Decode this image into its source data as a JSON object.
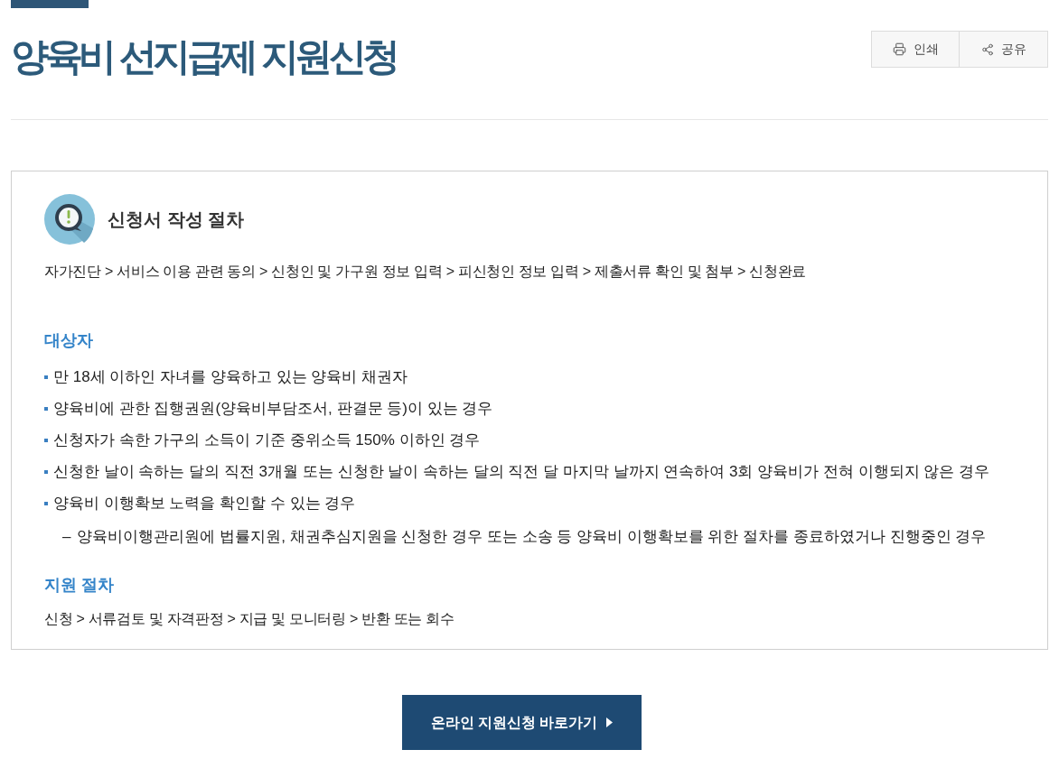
{
  "header": {
    "title": "양육비 선지급제 지원신청",
    "actions": [
      {
        "kind": "print",
        "label": "인쇄"
      },
      {
        "kind": "share",
        "label": "공유"
      }
    ]
  },
  "panel": {
    "heading": "신청서 작성 절차",
    "steps": "자가진단 > 서비스 이용 관련 동의 > 신청인 및 가구원 정보 입력 > 피신청인 정보 입력 > 제출서류 확인 및 첨부 > 신청완료",
    "sections": [
      {
        "kind": "list",
        "title": "대상자",
        "items": [
          {
            "text": "만 18세 이하인 자녀를 양육하고 있는 양육비 채권자"
          },
          {
            "text": "양육비에 관한 집행권원(양육비부담조서, 판결문 등)이 있는 경우"
          },
          {
            "text": "신청자가 속한 가구의 소득이 기준 중위소득 150% 이하인 경우"
          },
          {
            "text": "신청한 날이 속하는 달의 직전 3개월 또는 신청한 날이 속하는 달의 직전 달 마지막 날까지 연속하여 3회 양육비가 전혀 이행되지 않은 경우"
          },
          {
            "text": "양육비 이행확보 노력을 확인할 수 있는 경우",
            "children": [
              {
                "marker": "–",
                "text": "양육비이행관리원에 법률지원, 채권추심지원을 신청한 경우 또는 소송 등 양육비 이행확보를 위한 절차를 종료하였거나 진행중인 경우"
              }
            ]
          }
        ]
      },
      {
        "kind": "steps",
        "title": "지원 절차",
        "text": "신청 > 서류검토 및 자격판정 > 지급 및 모니터링 > 반환 또는 회수"
      }
    ]
  },
  "cta": {
    "label": "온라인 지원신청 바로가기"
  }
}
